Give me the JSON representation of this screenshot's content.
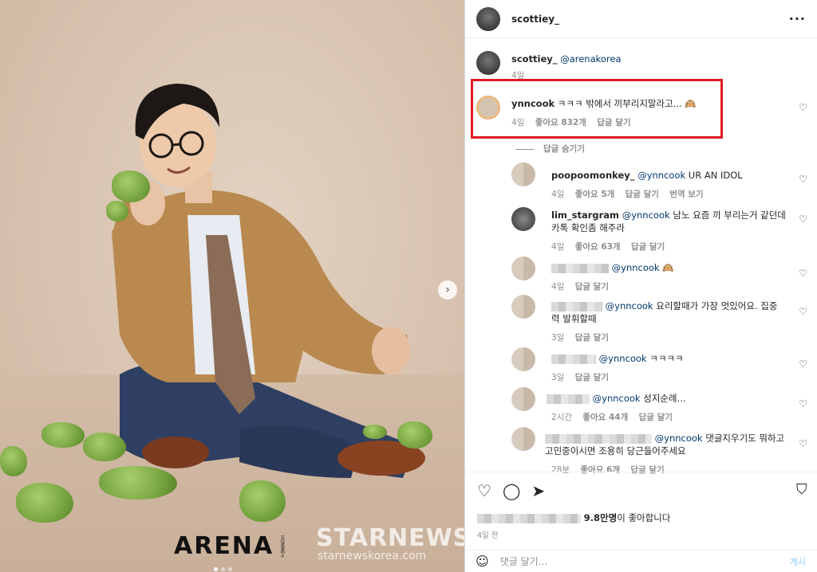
{
  "post": {
    "author": "scottiey_",
    "caption_author": "scottiey_",
    "caption_mention": "@arenakorea",
    "caption_age": "4일",
    "photo_logo": "ARENA",
    "photo_logo_sub": "HOMME+"
  },
  "highlighted_comment": {
    "user": "ynncook",
    "text": "ㅋㅋㅋ 밖에서 끼부리지말라고...",
    "emoji": "🙉",
    "age": "4일",
    "likes": "좋아요 832개",
    "reply": "답글 달기"
  },
  "hide_replies": "답글 숨기기",
  "replies": [
    {
      "user": "poopoomonkey_",
      "mention": "@ynncook",
      "text": "UR AN IDOL",
      "age": "4일",
      "likes": "좋아요 5개",
      "reply": "답글 달기",
      "translate": "번역 보기"
    },
    {
      "user": "lim_stargram",
      "mention": "@ynncook",
      "text": "남노 요즘 끼 부리는거 같던데",
      "text2": "카톡 확인좀 해주라",
      "age": "4일",
      "likes": "좋아요 63개",
      "reply": "답글 달기"
    },
    {
      "user": "",
      "mention": "@ynncook",
      "text": "🙉",
      "age": "4일",
      "likes": "",
      "reply": "답글 달기"
    },
    {
      "user": "",
      "mention": "@ynncook",
      "text": "요리할때가 가장 멋있어요. 집중",
      "text2": "력 발휘할때",
      "age": "3일",
      "likes": "",
      "reply": "답글 달기"
    },
    {
      "user": "",
      "mention": "@ynncook",
      "text": "ㅋㅋㅋㅋ",
      "age": "3일",
      "likes": "",
      "reply": "답글 달기"
    },
    {
      "user": "",
      "mention": "@ynncook",
      "text": "성지순례...",
      "age": "2시간",
      "likes": "좋아요 44개",
      "reply": "답글 달기"
    },
    {
      "user": "",
      "mention": "@ynncook",
      "text": "댓글지우기도 뭐하고",
      "text2": "고민중이시면 조용히 당근들어주세요",
      "age": "28분",
      "likes": "좋아요 6개",
      "reply": "답글 달기"
    }
  ],
  "likes_summary": {
    "count": "9.8만명",
    "suffix": "이 좋아합니다"
  },
  "post_time": "4일 전",
  "composer": {
    "placeholder": "댓글 달기...",
    "post_label": "게시"
  },
  "watermark": {
    "brand": "STARNEWS",
    "url": "starnewskorea.com"
  },
  "icons": {
    "like": "heart-icon",
    "comment": "comment-icon",
    "share": "share-icon",
    "save": "bookmark-icon",
    "emoji": "smiley-icon",
    "more": "more-icon",
    "next": "chevron-right-icon"
  },
  "colors": {
    "highlight_border": "#e01b24",
    "mention": "#00376b",
    "meta": "#8e8e8e"
  }
}
